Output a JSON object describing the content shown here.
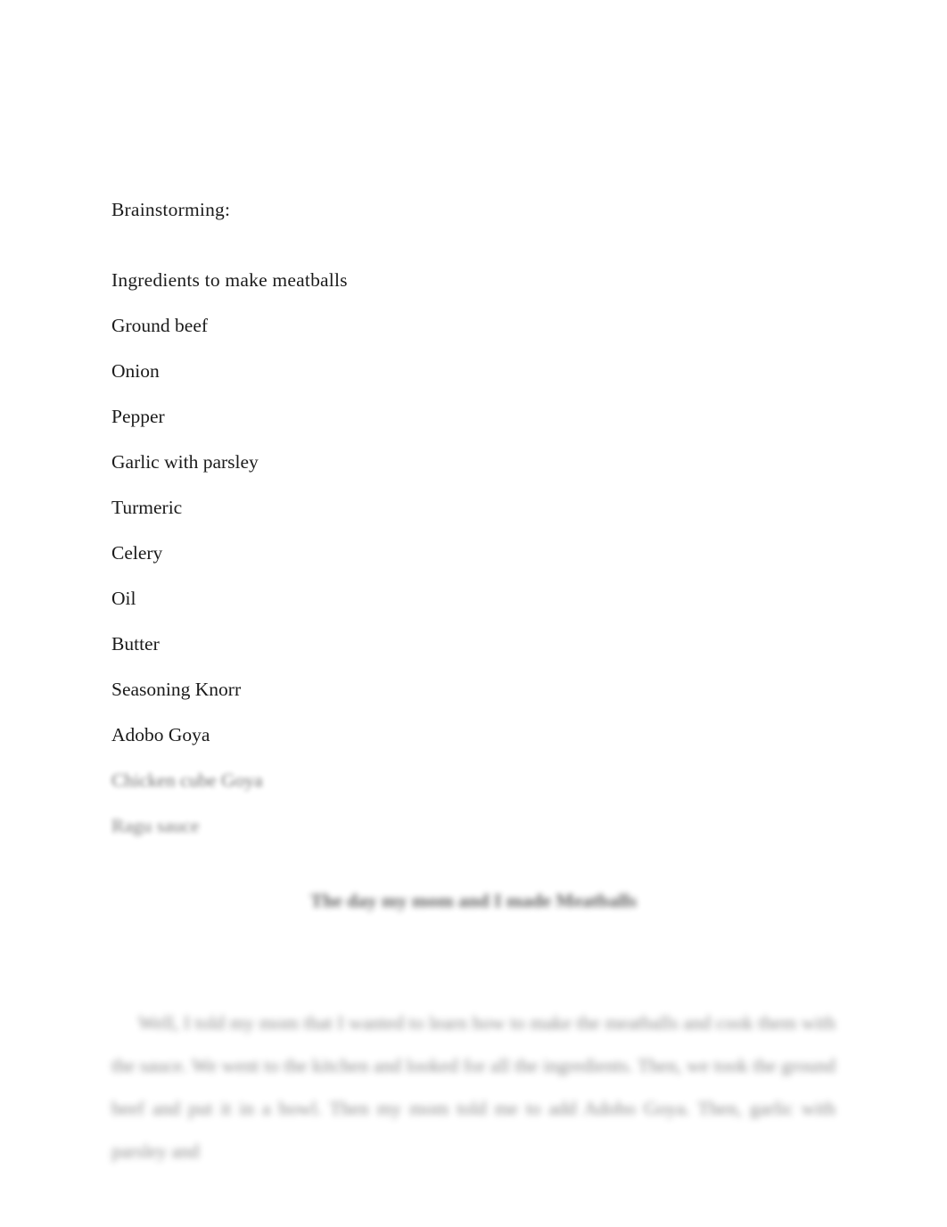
{
  "document": {
    "background_color": "#ffffff",
    "text_color": "#1b1b1b",
    "heading": "Brainstorming:",
    "ingredients_heading": "Ingredients to make meatballs",
    "ingredients": [
      "Ground beef",
      "Onion",
      "Pepper",
      "Garlic with parsley",
      "Turmeric",
      "Celery",
      "Oil",
      "Butter",
      "Seasoning Knorr",
      "Adobo Goya"
    ],
    "ingredients_blurred": [
      "Chicken cube Goya",
      "Ragu sauce"
    ],
    "essay": {
      "title": "The day my mom and I made Meatballs",
      "paragraph": "Well, I told my mom that I wanted to learn how to make the meatballs and cook them with the sauce. We went to the kitchen and looked for all the ingredients. Then, we took the ground beef and put it in a bowl. Then my mom told me to add Adobo Goya. Then, garlic with parsley and"
    }
  }
}
